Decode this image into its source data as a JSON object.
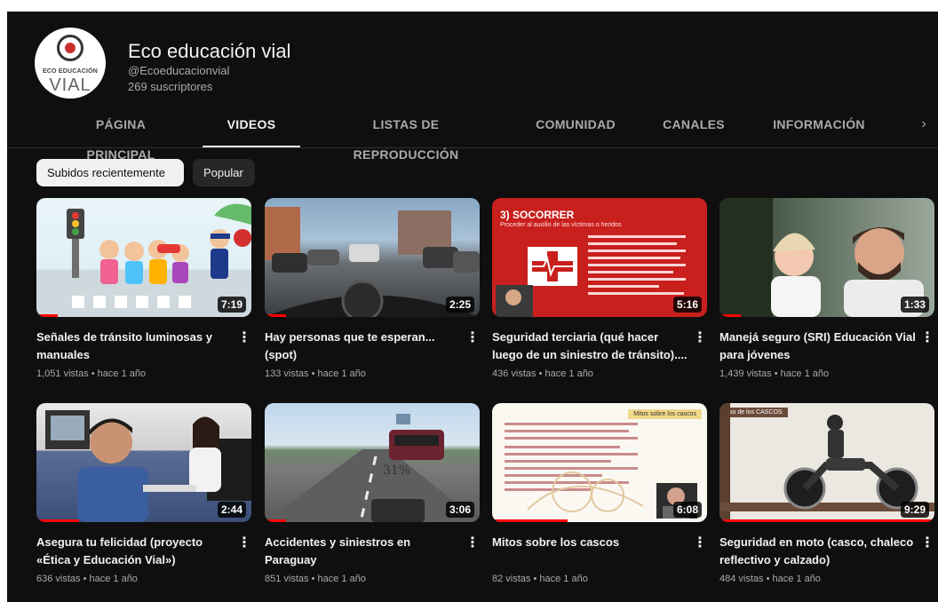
{
  "channel": {
    "logo_top": "ECO EDUCACIÓN",
    "logo_main": "VIAL",
    "title": "Eco educación vial",
    "handle": "@Ecoeducacionvial",
    "subscribers": "269 suscriptores"
  },
  "tabs": [
    {
      "label": "PÁGINA PRINCIPAL",
      "active": false
    },
    {
      "label": "VIDEOS",
      "active": true
    },
    {
      "label": "LISTAS DE REPRODUCCIÓN",
      "active": false
    },
    {
      "label": "COMUNIDAD",
      "active": false
    },
    {
      "label": "CANALES",
      "active": false
    },
    {
      "label": "INFORMACIÓN",
      "active": false
    }
  ],
  "tabs_next_icon": "chevron-right-icon",
  "chips": [
    {
      "label": "Subidos recientemente",
      "active": true
    },
    {
      "label": "Popular",
      "active": false
    }
  ],
  "videos": [
    {
      "title": "Señales de tránsito luminosas y manuales",
      "meta": "1,051 vistas • hace 1 año",
      "duration": "7:19",
      "progress": 0.1
    },
    {
      "title": "Hay personas que te esperan... (spot)",
      "meta": "133 vistas • hace 1 año",
      "duration": "2:25",
      "progress": 0.1
    },
    {
      "title": "Seguridad terciaria (qué hacer luego de un siniestro de tránsito)....",
      "meta": "436 vistas • hace 1 año",
      "duration": "5:16",
      "progress": 0.0,
      "thumb_text": {
        "heading": "3) SOCORRER",
        "sub": "Proceder al auxilio de las víctimas o heridos"
      }
    },
    {
      "title": "Manejá seguro (SRI) Educación Vial para jóvenes",
      "meta": "1,439 vistas • hace 1 año",
      "duration": "1:33",
      "progress": 0.1
    },
    {
      "title": "Asegura tu felicidad (proyecto «Ética y Educación Vial»)",
      "meta": "636 vistas • hace 1 año",
      "duration": "2:44",
      "progress": 0.2
    },
    {
      "title": "Accidentes y siniestros en Paraguay",
      "meta": "851 vistas • hace 1 año",
      "duration": "3:06",
      "progress": 0.1,
      "thumb_text": {
        "overlay": "31%"
      }
    },
    {
      "title": "Mitos sobre los cascos",
      "meta": "82 vistas • hace 1 año",
      "duration": "6:08",
      "progress": 0.35,
      "thumb_text": {
        "heading": "Mitos sobre los cascos"
      }
    },
    {
      "title": "Seguridad en moto (casco, chaleco reflectivo y calzado)",
      "meta": "484 vistas • hace 1 año",
      "duration": "9:29",
      "progress": 1.0,
      "thumb_text": {
        "heading": "Uso de los CASCOS"
      }
    }
  ],
  "colors": {
    "background": "#0f0f0f",
    "progress": "#ff0000",
    "text_primary": "#f1f1f1",
    "text_secondary": "#aaaaaa"
  }
}
